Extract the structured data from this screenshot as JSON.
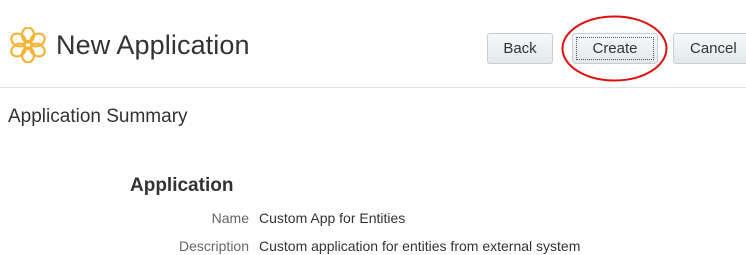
{
  "header": {
    "title": "New Application",
    "icon": "application-flower-icon",
    "icon_color": "#F5B335"
  },
  "toolbar": {
    "back_label": "Back",
    "create_label": "Create",
    "cancel_label": "Cancel",
    "highlight_color": "#E01010"
  },
  "summary": {
    "title": "Application Summary"
  },
  "application": {
    "heading": "Application",
    "fields": [
      {
        "label": "Name",
        "value": "Custom App for Entities"
      },
      {
        "label": "Description",
        "value": "Custom application for entities from external system"
      }
    ]
  }
}
